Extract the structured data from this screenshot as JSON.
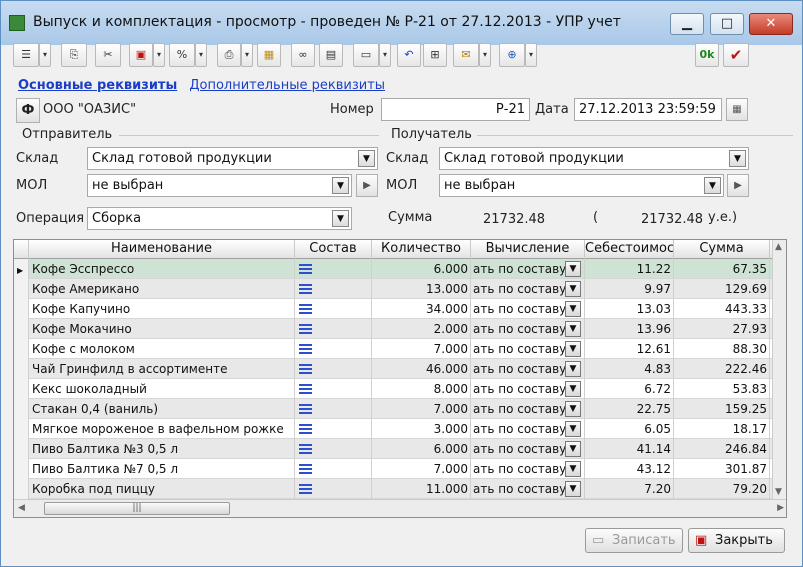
{
  "window": {
    "title": "Выпуск и комплектация - просмотр - проведен № Р-21 от 27.12.2013 - УПР учет",
    "minimize_icon": "minimize-icon",
    "maximize_icon": "maximize-icon",
    "close_icon": "close-icon"
  },
  "toolbar": {
    "ok_label": "0k",
    "check_label": "✔",
    "icons": [
      "list-icon",
      "copy-icon",
      "cut-icon",
      "document-red-icon",
      "percent-icon",
      "print-icon",
      "image-icon",
      "binoculars-icon",
      "book-icon",
      "card-icon",
      "undo-icon",
      "structure-icon",
      "envelope-icon",
      "network-icon"
    ]
  },
  "tabs": {
    "main": "Основные реквизиты",
    "extra": "Дополнительные реквизиты"
  },
  "header": {
    "org_button": "Ф",
    "org_name": "ООО \"ОАЗИС\"",
    "number_label": "Номер",
    "number_value": "Р-21",
    "date_label": "Дата",
    "date_value": "27.12.2013 23:59:59"
  },
  "sender": {
    "group_label": "Отправитель",
    "warehouse_label": "Склад",
    "warehouse_value": "Склад готовой продукции",
    "mol_label": "МОЛ",
    "mol_value": "не выбран"
  },
  "receiver": {
    "group_label": "Получатель",
    "warehouse_label": "Склад",
    "warehouse_value": "Склад готовой продукции",
    "mol_label": "МОЛ",
    "mol_value": "не выбран"
  },
  "operation": {
    "label": "Операция",
    "value": "Сборка",
    "sum_label": "Сумма",
    "sum_value": "21732.48",
    "paren": "(",
    "sum_ue": "21732.48",
    "ue_unit": "у.е.)"
  },
  "table": {
    "columns": [
      "Наименование",
      "Состав",
      "Количество",
      "Вычисление",
      "Себестоимость",
      "Сумма"
    ],
    "rows": [
      {
        "name": "Кофе Эсспрессо",
        "qty": "6.000",
        "calc": "ать по составу",
        "cost": "11.22",
        "sum": "67.35"
      },
      {
        "name": "Кофе Американо",
        "qty": "13.000",
        "calc": "ать по составу",
        "cost": "9.97",
        "sum": "129.69"
      },
      {
        "name": "Кофе Капучино",
        "qty": "34.000",
        "calc": "ать по составу",
        "cost": "13.03",
        "sum": "443.33"
      },
      {
        "name": "Кофе Мокачино",
        "qty": "2.000",
        "calc": "ать по составу",
        "cost": "13.96",
        "sum": "27.93"
      },
      {
        "name": "Кофе  с молоком",
        "qty": "7.000",
        "calc": "ать по составу",
        "cost": "12.61",
        "sum": "88.30"
      },
      {
        "name": "Чай Гринфилд в ассортименте",
        "qty": "46.000",
        "calc": "ать по составу",
        "cost": "4.83",
        "sum": "222.46"
      },
      {
        "name": "Кекс шоколадный",
        "qty": "8.000",
        "calc": "ать по составу",
        "cost": "6.72",
        "sum": "53.83"
      },
      {
        "name": "Стакан 0,4 (ваниль)",
        "qty": "7.000",
        "calc": "ать по составу",
        "cost": "22.75",
        "sum": "159.25"
      },
      {
        "name": "Мягкое мороженое в вафельном рожке",
        "qty": "3.000",
        "calc": "ать по составу",
        "cost": "6.05",
        "sum": "18.17"
      },
      {
        "name": "Пиво Балтика №3 0,5 л",
        "qty": "6.000",
        "calc": "ать по составу",
        "cost": "41.14",
        "sum": "246.84"
      },
      {
        "name": "Пиво Балтика №7 0,5 л",
        "qty": "7.000",
        "calc": "ать по составу",
        "cost": "43.12",
        "sum": "301.87"
      },
      {
        "name": "Коробка под пиццу",
        "qty": "11.000",
        "calc": "ать по составу",
        "cost": "7.20",
        "sum": "79.20"
      }
    ]
  },
  "buttons": {
    "save": "Записать",
    "close": "Закрыть"
  }
}
